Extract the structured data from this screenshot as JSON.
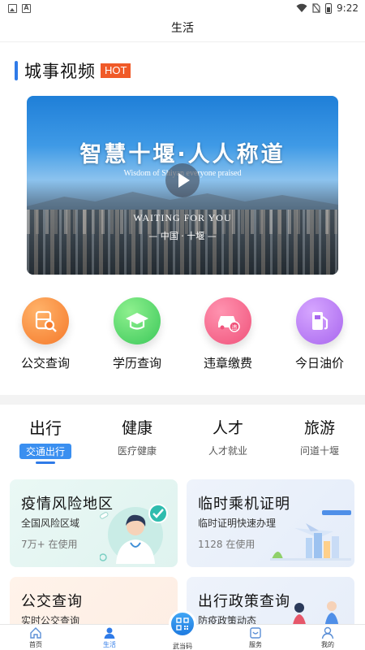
{
  "status_bar": {
    "time": "9:22"
  },
  "header": {
    "title": "生活"
  },
  "section": {
    "title": "城事视频",
    "badge": "HOT"
  },
  "video": {
    "headline": "智慧十堰·人人称道",
    "subtitle": "Wisdom of Shiyan everyone praised",
    "tagline": "WAITING FOR YOU",
    "place": "— 中国 · 十堰 —"
  },
  "quick_services": [
    {
      "label": "公交查询",
      "icon": "bus-search-icon",
      "color": "#f5792a"
    },
    {
      "label": "学历查询",
      "icon": "graduation-cap-icon",
      "color": "#3cc85a"
    },
    {
      "label": "违章缴费",
      "icon": "car-violation-icon",
      "color": "#f0527a"
    },
    {
      "label": "今日油价",
      "icon": "fuel-pump-icon",
      "color": "#a866ee"
    }
  ],
  "categories": [
    {
      "title": "出行",
      "sub": "交通出行"
    },
    {
      "title": "健康",
      "sub": "医疗健康"
    },
    {
      "title": "人才",
      "sub": "人才就业"
    },
    {
      "title": "旅游",
      "sub": "问道十堰"
    }
  ],
  "active_category": 0,
  "cards": [
    {
      "title": "疫情风险地区",
      "desc": "全国风险区域",
      "count": "7万+ 在使用"
    },
    {
      "title": "临时乘机证明",
      "desc": "临时证明快速办理",
      "count": "1128 在使用"
    },
    {
      "title": "公交查询",
      "desc": "实时公交查询"
    },
    {
      "title": "出行政策查询",
      "desc": "防疫政策动态"
    }
  ],
  "bottom_nav": [
    {
      "label": "首页",
      "icon": "home-icon"
    },
    {
      "label": "生活",
      "icon": "person-icon"
    },
    {
      "label": "武当码",
      "icon": "qr-code-icon"
    },
    {
      "label": "服务",
      "icon": "service-icon"
    },
    {
      "label": "我的",
      "icon": "user-icon"
    }
  ],
  "active_nav": 1
}
